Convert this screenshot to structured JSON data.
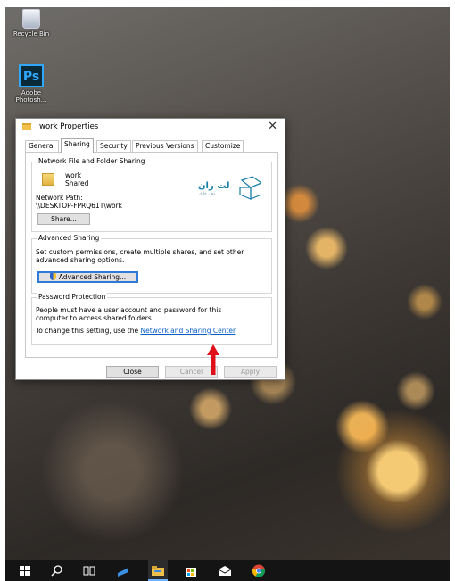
{
  "desktop": {
    "icons": [
      {
        "name": "recycle-bin",
        "label": "Recycle Bin"
      },
      {
        "name": "photoshop",
        "label": "Adobe Photosh...",
        "glyph": "Ps"
      }
    ]
  },
  "window": {
    "title": "work Properties",
    "close_glyph": "✕",
    "tabs": [
      "General",
      "Sharing",
      "Security",
      "Previous Versions",
      "Customize"
    ],
    "active_tab": "Sharing",
    "network_sharing": {
      "title": "Network File and Folder Sharing",
      "folder_name": "work",
      "status": "Shared",
      "path_label": "Network Path:",
      "path": "\\\\DESKTOP-FPRQ61T\\work",
      "share_button": "Share..."
    },
    "advanced_sharing": {
      "title": "Advanced Sharing",
      "description_line1": "Set custom permissions, create multiple shares, and set other",
      "description_line2": "advanced sharing options.",
      "button": "Advanced Sharing..."
    },
    "password_protection": {
      "title": "Password Protection",
      "description_line1": "People must have a user account and password for this",
      "description_line2": "computer to access shared folders.",
      "change_text": "To change this setting, use the",
      "link_text": "Network and Sharing Center",
      "period": "."
    },
    "buttons": {
      "close": "Close",
      "cancel": "Cancel",
      "apply": "Apply"
    }
  },
  "watermark": {
    "text": "لت ران",
    "subtext": "ذهن خلاق"
  },
  "taskbar": {
    "items": [
      "windows-start",
      "search",
      "task-view",
      "app-blue",
      "file-explorer",
      "store",
      "mail",
      "chrome"
    ]
  },
  "colors": {
    "accent": "#0b5ec7",
    "arrow": "#e0101a",
    "focus_border": "#2f7ad8",
    "taskbar": "#141414"
  }
}
